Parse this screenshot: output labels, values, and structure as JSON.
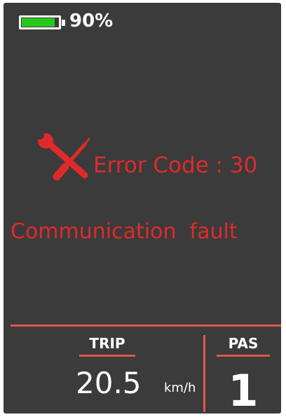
{
  "status_bar": {
    "battery_level": 0.9,
    "battery_color": "#27c91b",
    "battery_percent_text": "90%",
    "battery_icon": "battery-icon"
  },
  "error": {
    "icon": "wrench-screwdriver-icon",
    "code_text": "Error Code : 30",
    "message": "Communication  fault",
    "color": "#e02a2a"
  },
  "dashboard": {
    "trip_label": "TRIP",
    "speed_value": "20.5",
    "speed_unit": "km/h",
    "pas_label": "PAS",
    "pas_value": "1",
    "accent_color": "#e0574a"
  }
}
